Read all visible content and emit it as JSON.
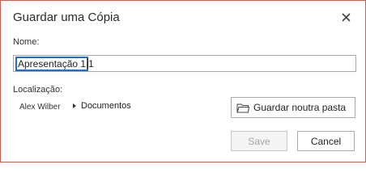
{
  "dialog": {
    "title": "Guardar uma Cópia",
    "name_label": "Nome:",
    "name_value_selected": "Apresentação 1",
    "name_value_rest": "1",
    "location_label": "Localização:",
    "location_user": "Alex Wilber",
    "location_folder": "Documentos",
    "folder_button_label": "Guardar noutra pasta",
    "save_label": "Save",
    "cancel_label": "Cancel",
    "save_enabled": false,
    "colors": {
      "border": "#d35a48",
      "selection": "#1e6fc8"
    },
    "icons": {
      "close": "close-icon",
      "folder": "folder-icon",
      "expand": "chevron-right-icon"
    }
  }
}
